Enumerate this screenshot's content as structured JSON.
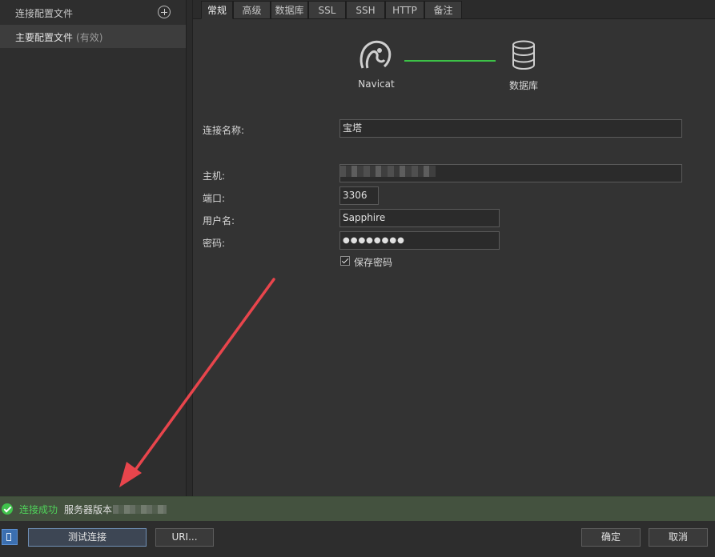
{
  "sidebar": {
    "title": "连接配置文件",
    "items": [
      {
        "label": "主要配置文件",
        "status": "(有效)"
      }
    ]
  },
  "tabs": [
    "常规",
    "高级",
    "数据库",
    "SSL",
    "SSH",
    "HTTP",
    "备注"
  ],
  "active_tab": "常规",
  "diagram": {
    "left_label": "Navicat",
    "right_label": "数据库",
    "line_color": "#3cc247"
  },
  "form": {
    "name_label": "连接名称:",
    "name_value": "宝塔",
    "host_label": "主机:",
    "host_value": "",
    "port_label": "端口:",
    "port_value": "3306",
    "user_label": "用户名:",
    "user_value": "Sapphire",
    "password_label": "密码:",
    "password_value": "●●●●●●●●",
    "save_password_label": "保存密码",
    "save_password_checked": true
  },
  "status": {
    "text": "连接成功",
    "server_version_label": "服务器版本",
    "color": "#4fd35a"
  },
  "buttons": {
    "test": "测试连接",
    "uri": "URI...",
    "ok": "确定",
    "cancel": "取消"
  },
  "colors": {
    "accent": "#3b6fb0",
    "success": "#40c34c",
    "annotation_arrow": "#e8454c"
  },
  "icons": [
    "add-circle-icon",
    "navicat-logo-icon",
    "database-icon",
    "check-circle-icon",
    "sidebar-toggle-icon"
  ]
}
